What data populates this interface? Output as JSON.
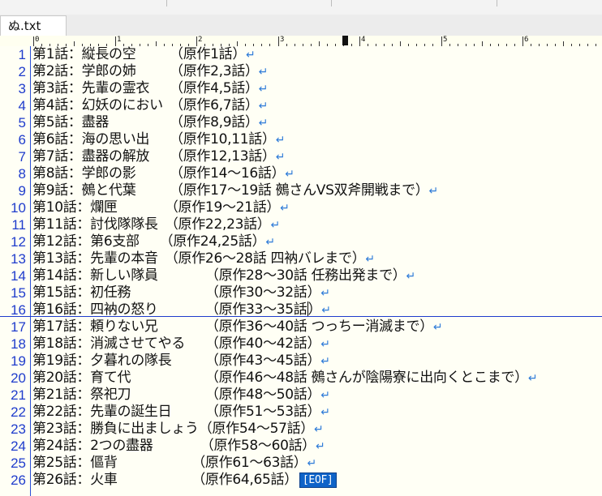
{
  "tab": {
    "filename": "ぬ.txt"
  },
  "ruler": {
    "labels": [
      "0",
      "1",
      "2",
      "3",
      "4",
      "5",
      "6"
    ]
  },
  "editor": {
    "eof_label": "[EOF]",
    "return_mark": "↵",
    "current_line": 16,
    "lines": [
      {
        "num": "1",
        "text": "第1話：縦長の空　　　（原作1話）"
      },
      {
        "num": "2",
        "text": "第2話：学郎の姉　　　（原作2,3話）"
      },
      {
        "num": "3",
        "text": "第3話：先輩の霊衣　　（原作4,5話）"
      },
      {
        "num": "4",
        "text": "第4話：幻妖のにおい　（原作6,7話）"
      },
      {
        "num": "5",
        "text": "第5話：盡器　　　　　（原作8,9話）"
      },
      {
        "num": "6",
        "text": "第6話：海の思い出　　（原作10,11話）"
      },
      {
        "num": "7",
        "text": "第7話：盡器の解放　　（原作12,13話）"
      },
      {
        "num": "8",
        "text": "第8話：学郎の影　　　（原作14～16話）"
      },
      {
        "num": "9",
        "text": "第9話：鵺と代葉　　　（原作17～19話 鵺さんVS双斧開戦まで）"
      },
      {
        "num": "10",
        "text": "第10話：爛匣　　　　（原作19～21話）"
      },
      {
        "num": "11",
        "text": "第11話：討伐隊隊長　（原作22,23話）"
      },
      {
        "num": "12",
        "text": "第12話：第6支部　　（原作24,25話）"
      },
      {
        "num": "13",
        "text": "第13話：先輩の本音　（原作26～28話 四衲バレまで）"
      },
      {
        "num": "14",
        "text": "第14話：新しい隊員　　　　（原作28～30話 任務出発まで）"
      },
      {
        "num": "15",
        "text": "第15話：初任務　　　　　　（原作30～32話）"
      },
      {
        "num": "16",
        "text": "第16話：四衲の怒り　　　　（原作33～35話"
      },
      {
        "num": "17",
        "text": "第17話：頼りない兄　　　　（原作36～40話 つっちー消滅まで）"
      },
      {
        "num": "18",
        "text": "第18話：消滅させてやる　　（原作40～42話）"
      },
      {
        "num": "19",
        "text": "第19話：夕暮れの隊長　　　（原作43～45話）"
      },
      {
        "num": "20",
        "text": "第20話：育て代　　　　　　（原作46～48話 鵺さんが陰陽寮に出向くとこまで）"
      },
      {
        "num": "21",
        "text": "第21話：祭祀刀　　　　　　（原作48～50話）"
      },
      {
        "num": "22",
        "text": "第22話：先輩の誕生日　　　（原作51～53話）"
      },
      {
        "num": "23",
        "text": "第23話：勝負に出ましょう（原作54～57話）"
      },
      {
        "num": "24",
        "text": "第24話：2つの盡器　　　　（原作58～60話）"
      },
      {
        "num": "25",
        "text": "第25話：傴背　　　　　　（原作61～63話）"
      },
      {
        "num": "26",
        "text": "第26話：火車　　　　　　（原作64,65話）"
      }
    ]
  }
}
